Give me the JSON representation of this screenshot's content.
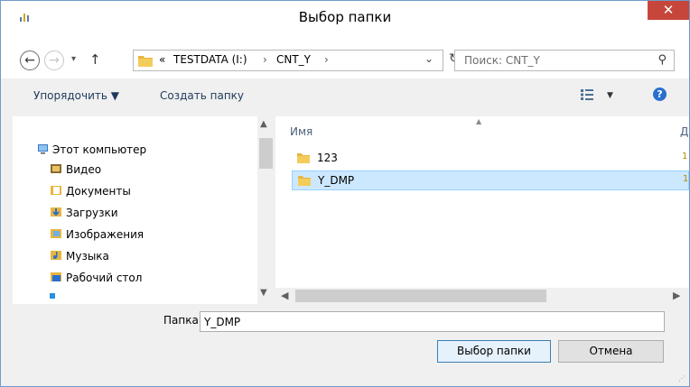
{
  "window": {
    "title": "Выбор папки",
    "close_glyph": "✕"
  },
  "navigation": {
    "back_glyph": "←",
    "forward_glyph": "→",
    "recent_glyph": "▾",
    "up_glyph": "↑",
    "breadcrumb": {
      "overflow": "«",
      "items": [
        "TESTDATA (I:)",
        "CNT_Y"
      ],
      "separator": "›",
      "dropdown_glyph": "⌄"
    },
    "refresh_glyph": "↻",
    "search": {
      "placeholder": "Поиск: CNT_Y",
      "icon_glyph": "⚲"
    }
  },
  "toolbar": {
    "organize_label": "Упорядочить ▼",
    "new_folder_label": "Создать папку",
    "view_dropdown_glyph": "▼",
    "help_glyph": "?"
  },
  "nav_pane": {
    "root": "Этот компьютер",
    "items": [
      "Видео",
      "Документы",
      "Загрузки",
      "Изображения",
      "Музыка",
      "Рабочий стол"
    ]
  },
  "file_list": {
    "column_name": "Имя",
    "column_next_partial": "Д",
    "rows": [
      {
        "name": "123",
        "selected": false
      },
      {
        "name": "Y_DMP",
        "selected": true
      }
    ]
  },
  "footer": {
    "folder_label": "Папка:",
    "folder_value": "Y_DMP",
    "select_button": "Выбор папки",
    "cancel_button": "Отмена"
  },
  "colors": {
    "close_button": "#c7463b",
    "selection": "#cce8ff",
    "folder_icon": "#e8b53e"
  }
}
